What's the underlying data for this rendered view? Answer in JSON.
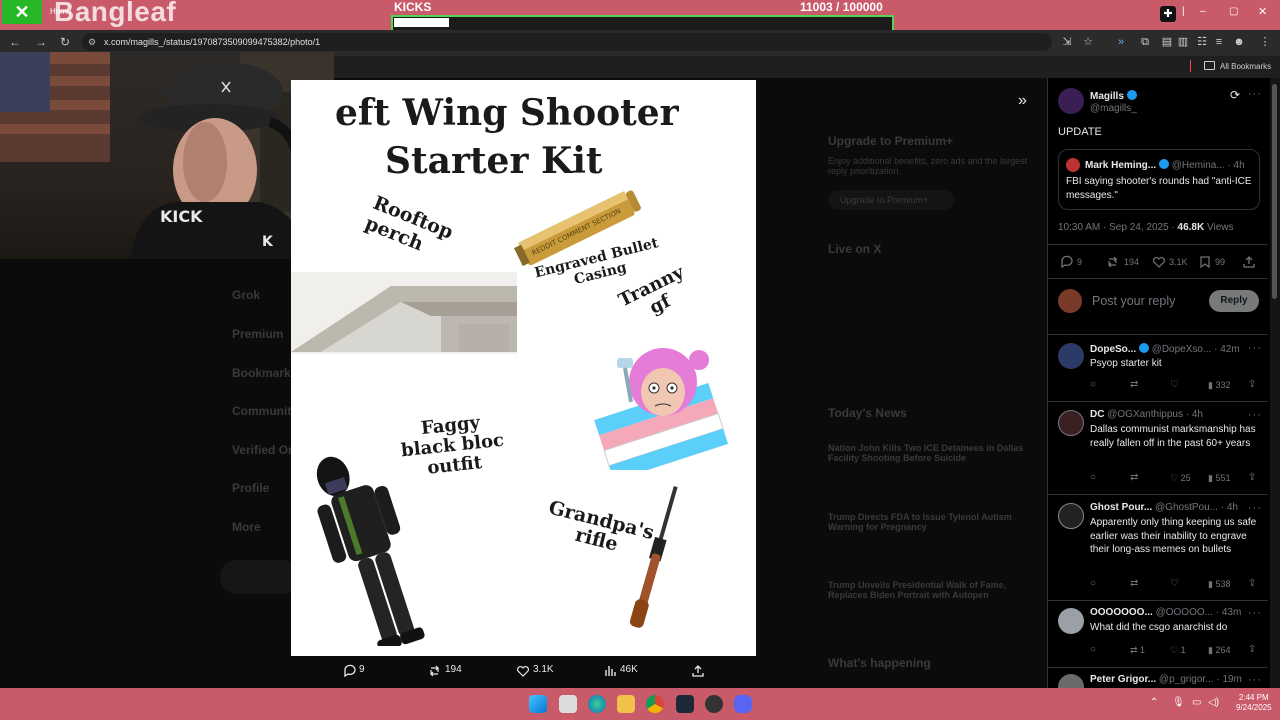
{
  "stream_overlay": {
    "logo_text": "Bangleaf",
    "goal": {
      "label": "KICKS",
      "current": "11003",
      "separator": " / ",
      "target": "100000",
      "progress_fraction": 0.11
    }
  },
  "browser": {
    "tab_label": "Home",
    "url": "x.com/magills_/status/1970873509099475382/photo/1",
    "bookmarks_label": "All Bookmarks"
  },
  "meme": {
    "title_line1": "eft Wing Shooter",
    "title_line2": "Starter Kit",
    "label_rooftop": [
      "Rooftop",
      "perch"
    ],
    "label_bullet": [
      "Engraved Bullet",
      "Casing"
    ],
    "bullet_engraving": "REDDIT COMMENT SECTION",
    "label_gf": [
      "Tranny",
      "gf"
    ],
    "label_outfit": [
      "Faggy",
      "black bloc",
      "outfit"
    ],
    "label_rifle": [
      "Grandpa's",
      "rifle"
    ]
  },
  "image_stats": {
    "replies": "9",
    "reposts": "194",
    "likes": "3.1K",
    "views": "46K"
  },
  "post": {
    "author_name": "Magills",
    "author_handle": "@magills_",
    "text": "UPDATE",
    "quote": {
      "author_name": "Mark Heming...",
      "author_handle": "@Hemina...",
      "age": "4h",
      "text": "FBI saying shooter's rounds had \"anti-ICE messages.\""
    },
    "timestamp": "10:30 AM · Sep 24, 2025 · ",
    "views_count": "46.8K",
    "views_label": " Views",
    "stats": {
      "replies": "9",
      "reposts": "194",
      "likes": "3.1K",
      "bookmarks": "99"
    },
    "reply_placeholder": "Post your reply",
    "reply_button": "Reply"
  },
  "replies": [
    {
      "name": "DopeSo...",
      "handle": "@DopeXso...",
      "age": "42m",
      "text": "Psyop starter kit",
      "retweets": "",
      "likes": "",
      "views": "332"
    },
    {
      "name": "DC",
      "handle": "@OGXanthippus",
      "age": "4h",
      "text": "Dallas communist marksmanship has really fallen off in the past 60+ years",
      "retweets": "",
      "likes": "25",
      "views": "551"
    },
    {
      "name": "Ghost Pour...",
      "handle": "@GhostPou...",
      "age": "4h",
      "text": "Apparently only thing keeping us safe earlier was their inability to engrave their long-ass memes on bullets",
      "retweets": "",
      "likes": "",
      "views": "538"
    },
    {
      "name": "OOOOOOO...",
      "handle": "@OOOOO...",
      "age": "43m",
      "text": "What did the csgo anarchist do",
      "retweets": "1",
      "likes": "1",
      "views": "264"
    },
    {
      "name": "Peter Grigor...",
      "handle": "@p_grigor...",
      "age": "19m",
      "text": ""
    }
  ],
  "background_page": {
    "sidebar": [
      "Grok",
      "Premium",
      "Bookmarks",
      "Communities",
      "Verified Orgs",
      "Profile",
      "More"
    ],
    "premium_title": "Upgrade to Premium+",
    "premium_desc": "Enjoy additional benefits, zero ads and the largest reply prioritization.",
    "premium_button": "Upgrade to Premium+",
    "live_title": "Live on X",
    "news_title": "Today's News",
    "news": [
      "Nation John Kills Two ICE Detainees in Dallas Facility Shooting Before Suicide",
      "Trump Directs FDA to Issue Tylenol Autism Warning for Pregnancy",
      "Trump Unveils Presidential Walk of Fame, Replaces Biden Portrait with Autopen"
    ],
    "happening_title": "What's happening"
  },
  "taskbar": {
    "time": "2:44 PM",
    "date": "9/24/2025"
  },
  "colors": {
    "chrome": "#c85a6a",
    "accent": "#1d9bf0",
    "goal_border": "#53d653"
  }
}
